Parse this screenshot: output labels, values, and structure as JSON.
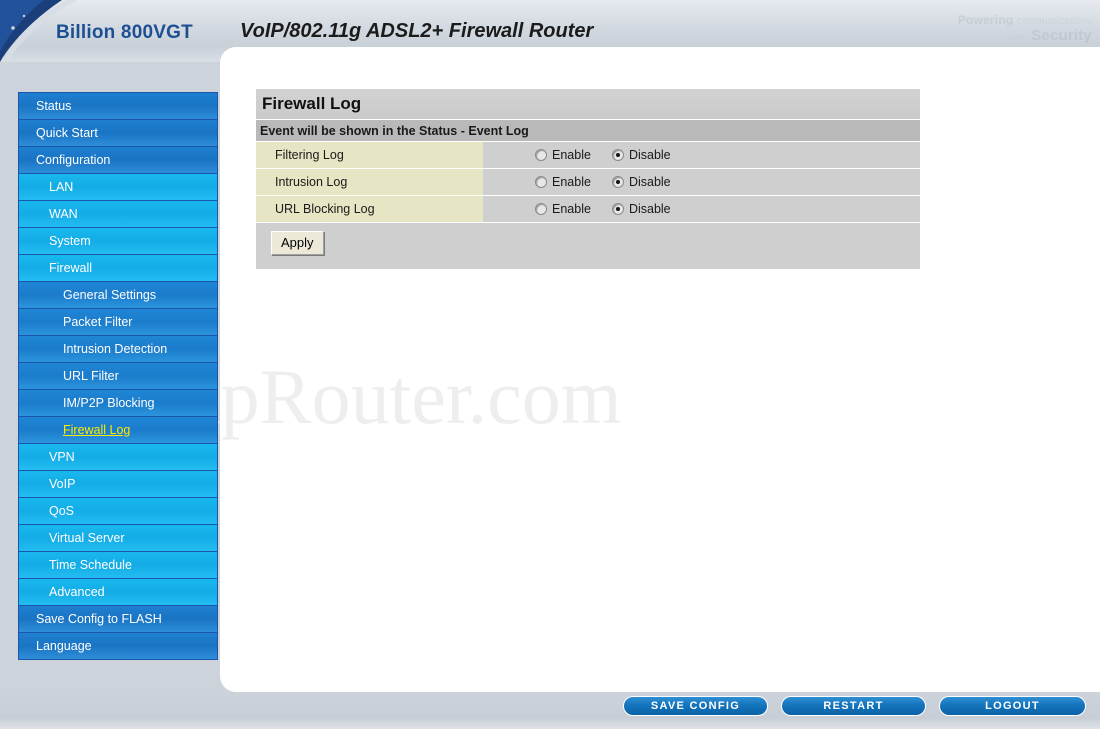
{
  "header": {
    "brand": "Billion 800VGT",
    "model_title": "VoIP/802.11g ADSL2+ Firewall Router",
    "tagline_line1_bold": "Powering",
    "tagline_line1_thin": "communications",
    "tagline_line2_thin": "with",
    "tagline_line2_bold": "Security",
    "swoosh_icon": "corner-swoosh-icon",
    "brand_color": "#1d4f93"
  },
  "watermark": {
    "text": "setupRouter.com"
  },
  "sidebar": {
    "items": [
      {
        "label": "Status",
        "level": 0,
        "active": false
      },
      {
        "label": "Quick Start",
        "level": 0,
        "active": false
      },
      {
        "label": "Configuration",
        "level": 0,
        "active": false
      },
      {
        "label": "LAN",
        "level": 1,
        "active": false
      },
      {
        "label": "WAN",
        "level": 1,
        "active": false
      },
      {
        "label": "System",
        "level": 1,
        "active": false
      },
      {
        "label": "Firewall",
        "level": 1,
        "active": false
      },
      {
        "label": "General Settings",
        "level": 2,
        "active": false
      },
      {
        "label": "Packet Filter",
        "level": 2,
        "active": false
      },
      {
        "label": "Intrusion Detection",
        "level": 2,
        "active": false
      },
      {
        "label": "URL Filter",
        "level": 2,
        "active": false
      },
      {
        "label": "IM/P2P Blocking",
        "level": 2,
        "active": false
      },
      {
        "label": "Firewall Log",
        "level": 2,
        "active": true
      },
      {
        "label": "VPN",
        "level": 1,
        "active": false
      },
      {
        "label": "VoIP",
        "level": 1,
        "active": false
      },
      {
        "label": "QoS",
        "level": 1,
        "active": false
      },
      {
        "label": "Virtual Server",
        "level": 1,
        "active": false
      },
      {
        "label": "Time Schedule",
        "level": 1,
        "active": false
      },
      {
        "label": "Advanced",
        "level": 1,
        "active": false
      },
      {
        "label": "Save Config to FLASH",
        "level": 0,
        "active": false
      },
      {
        "label": "Language",
        "level": 0,
        "active": false
      }
    ],
    "active_color": "#ffea00"
  },
  "main": {
    "page_title": "Firewall Log",
    "subtitle": "Event will be shown in the Status - Event Log",
    "radio_enable_label": "Enable",
    "radio_disable_label": "Disable",
    "rows": [
      {
        "label": "Filtering Log",
        "selected": "Disable"
      },
      {
        "label": "Intrusion Log",
        "selected": "Disable"
      },
      {
        "label": "URL Blocking Log",
        "selected": "Disable"
      }
    ],
    "apply_label": "Apply"
  },
  "bottom_bar": {
    "save_config_label": "SAVE CONFIG",
    "restart_label": "RESTART",
    "logout_label": "LOGOUT"
  }
}
